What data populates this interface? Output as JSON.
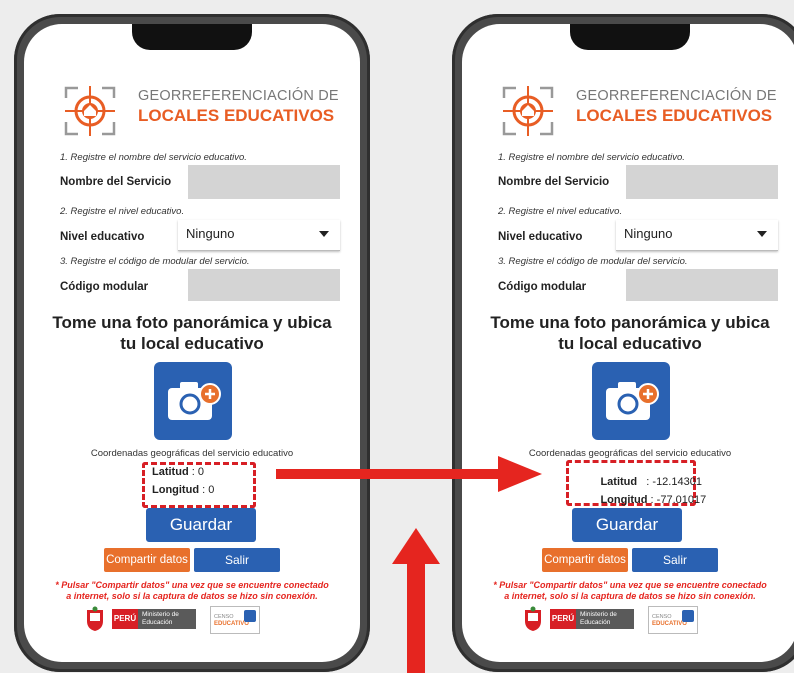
{
  "colors": {
    "brand_orange": "#e85d24",
    "primary_blue": "#2a61b2",
    "alert_red": "#d71f25",
    "input_gray": "#d4d4d4"
  },
  "screens": [
    {
      "brand": {
        "line1": "GEORREFERENCIACIÓN DE",
        "line2": "LOCALES EDUCATIVOS"
      },
      "step1": "1. Registre el nombre del servicio educativo.",
      "service_name_label": "Nombre del Servicio",
      "service_name_value": "",
      "step2": "2. Registre el nivel educativo.",
      "level_label": "Nivel educativo",
      "level_value": "Ninguno",
      "step3": "3. Registre el código de modular del servicio.",
      "modular_label": "Código modular",
      "modular_value": "",
      "heading": "Tome una foto panorámica y ubica tu local educativo",
      "camera_icon": "camera-add-icon",
      "coords_caption": "Coordenadas geográficas del servicio educativo",
      "lat_label": "Latitud",
      "lat_sep": " : ",
      "lat_value": "0",
      "lon_label": "Longitud",
      "lon_sep": " : ",
      "lon_value": "0",
      "save_label": "Guardar",
      "share_label": "Compartir datos",
      "exit_label": "Salir",
      "notice": "* Pulsar \"Compartir datos\" una vez que se encuentre conectado a internet, solo si la captura de datos se hizo sin conexión.",
      "footer": {
        "peru": "PERÚ",
        "ministry": "Ministerio de Educación",
        "censo_line1": "CENSO",
        "censo_line2": "EDUCATIVO"
      }
    },
    {
      "brand": {
        "line1": "GEORREFERENCIACIÓN DE",
        "line2": "LOCALES EDUCATIVOS"
      },
      "step1": "1. Registre el nombre del servicio educativo.",
      "service_name_label": "Nombre del Servicio",
      "service_name_value": "",
      "step2": "2. Registre el nivel educativo.",
      "level_label": "Nivel educativo",
      "level_value": "Ninguno",
      "step3": "3. Registre el código de modular del servicio.",
      "modular_label": "Código modular",
      "modular_value": "",
      "heading": "Tome una foto panorámica y ubica tu local educativo",
      "camera_icon": "camera-add-icon",
      "coords_caption": "Coordenadas geográficas del servicio educativo",
      "lat_label": "Latitud",
      "lat_sep": "   : ",
      "lat_value": "-12.14301",
      "lon_label": "Longitud",
      "lon_sep": " : ",
      "lon_value": "-77.01017",
      "save_label": "Guardar",
      "share_label": "Compartir datos",
      "exit_label": "Salir",
      "notice": "* Pulsar \"Compartir datos\" una vez que se encuentre conectado a internet, solo si la captura de datos se hizo sin conexión.",
      "footer": {
        "peru": "PERÚ",
        "ministry": "Ministerio de Educación",
        "censo_line1": "CENSO",
        "censo_line2": "EDUCATIVO"
      }
    }
  ]
}
